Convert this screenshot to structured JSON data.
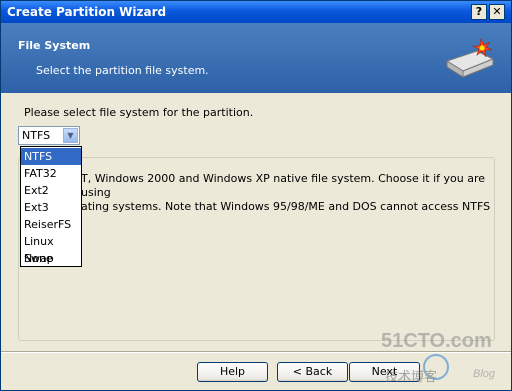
{
  "window": {
    "title": "Create Partition Wizard",
    "help_button": "?",
    "close_button": "✕"
  },
  "header": {
    "title": "File System",
    "subtitle": "Select the partition file system."
  },
  "main": {
    "prompt": "Please select file system for the partition.",
    "selected_value": "NTFS",
    "options": [
      "NTFS",
      "FAT32",
      "Ext2",
      "Ext3",
      "ReiserFS",
      "Linux Swap",
      "None"
    ],
    "description_lines": [
      "T, Windows 2000 and Windows XP native file system. Choose it if you are using",
      "ating systems. Note that Windows 95/98/ME and DOS cannot access NTFS"
    ]
  },
  "buttons": {
    "help": "Help",
    "back": "< Back",
    "next": "Next"
  },
  "watermark": {
    "text1": "51CTO.com",
    "text2": "技术博客",
    "text3": "Blog"
  },
  "colors": {
    "title_bar": "#0a59dd",
    "header_band": "#2e61a8",
    "selection": "#316ac5",
    "window_face": "#ece9d8"
  }
}
